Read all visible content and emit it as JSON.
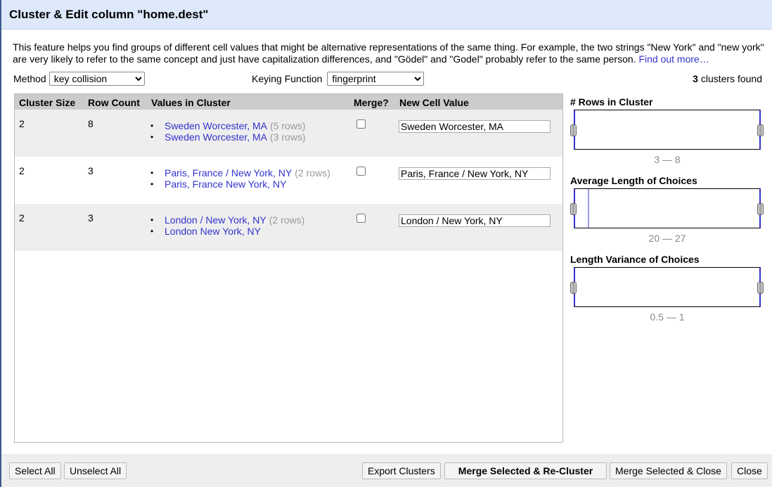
{
  "dialog": {
    "title": "Cluster & Edit column \"home.dest\""
  },
  "description": {
    "text": "This feature helps you find groups of different cell values that might be alternative representations of the same thing. For example, the two strings \"New York\" and \"new york\" are very likely to refer to the same concept and just have capitalization differences, and \"Gödel\" and \"Godel\" probably refer to the same person. ",
    "link": "Find out more…"
  },
  "controls": {
    "method_label": "Method",
    "method_value": "key collision",
    "keying_label": "Keying Function",
    "keying_value": "fingerprint",
    "clusters_count": "3",
    "clusters_suffix": " clusters found"
  },
  "table": {
    "headers": [
      "Cluster Size",
      "Row Count",
      "Values in Cluster",
      "Merge?",
      "New Cell Value"
    ],
    "rows": [
      {
        "size": "2",
        "count": "8",
        "values": [
          {
            "v": "Sweden Worcester, MA",
            "c": "(5 rows)"
          },
          {
            "v": "Sweden  Worcester, MA",
            "c": "(3 rows)"
          }
        ],
        "merge": false,
        "new": "Sweden Worcester, MA"
      },
      {
        "size": "2",
        "count": "3",
        "values": [
          {
            "v": "Paris, France / New York, NY",
            "c": "(2 rows)"
          },
          {
            "v": "Paris, France New York, NY",
            "c": ""
          }
        ],
        "merge": false,
        "new": "Paris, France / New York, NY"
      },
      {
        "size": "2",
        "count": "3",
        "values": [
          {
            "v": "London / New York, NY",
            "c": "(2 rows)"
          },
          {
            "v": "London New York, NY",
            "c": ""
          }
        ],
        "merge": false,
        "new": "London / New York, NY"
      }
    ]
  },
  "facets": [
    {
      "title": "# Rows in Cluster",
      "range": "3 — 8"
    },
    {
      "title": "Average Length of Choices",
      "range": "20 — 27"
    },
    {
      "title": "Length Variance of Choices",
      "range": "0.5 — 1"
    }
  ],
  "footer": {
    "select_all": "Select All",
    "unselect_all": "Unselect All",
    "export": "Export Clusters",
    "merge_recluster": "Merge Selected & Re-Cluster",
    "merge_close": "Merge Selected & Close",
    "close": "Close"
  }
}
